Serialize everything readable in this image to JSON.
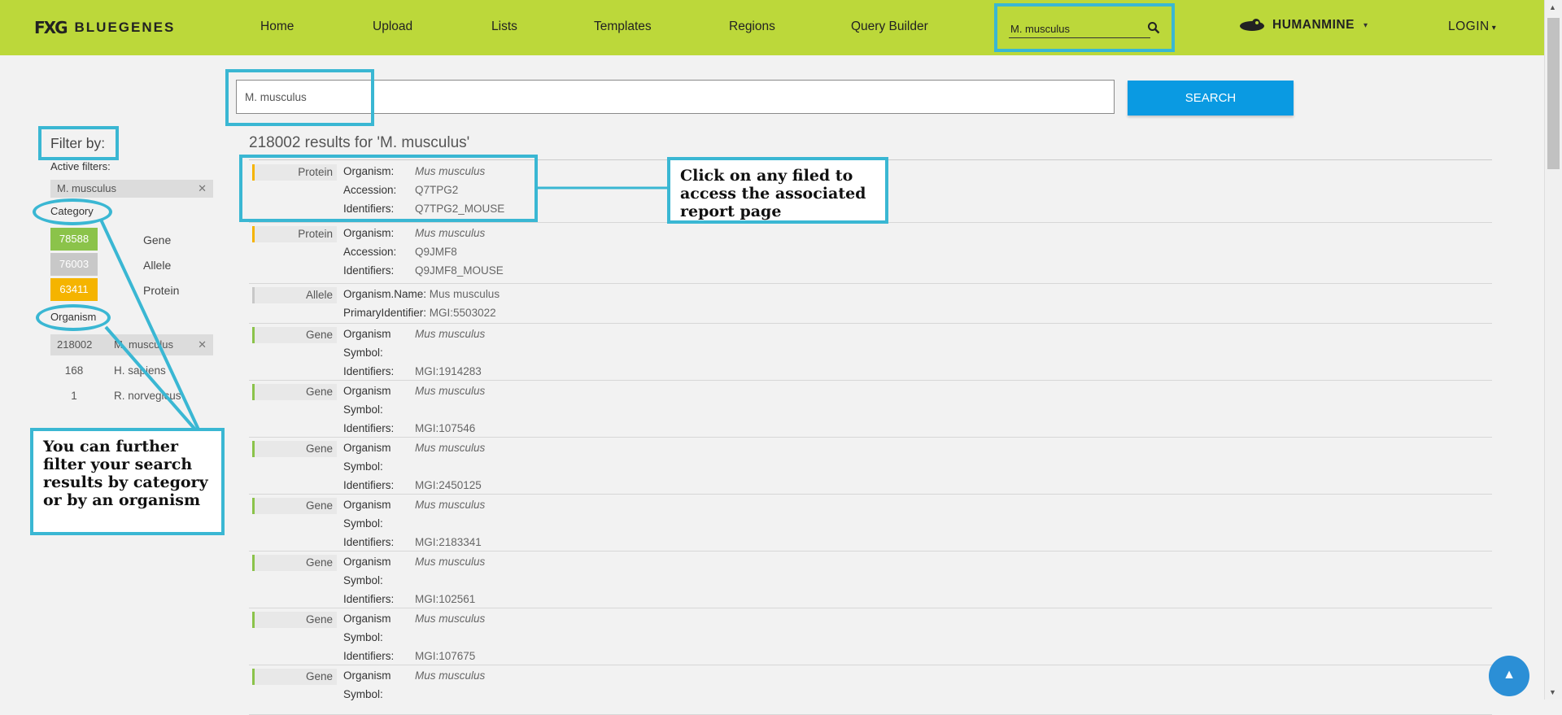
{
  "navbar": {
    "brand_logo": "FXG",
    "brand_name": "BLUEGENES",
    "links": [
      "Home",
      "Upload",
      "Lists",
      "Templates",
      "Regions",
      "Query Builder"
    ],
    "search_value": "M. musculus",
    "mine_name": "HUMANMINE",
    "login_label": "LOGIN"
  },
  "search": {
    "value": "M. musculus",
    "button_label": "SEARCH",
    "results_title": "218002 results for 'M. musculus'"
  },
  "filters": {
    "title": "Filter by:",
    "active_label": "Active filters:",
    "active_chip": "M. musculus",
    "close_glyph": "✕",
    "category_label": "Category",
    "categories": [
      {
        "count": "78588",
        "name": "Gene",
        "color": "#8bc34a"
      },
      {
        "count": "76003",
        "name": "Allele",
        "color": "#c8c8c8"
      },
      {
        "count": "63411",
        "name": "Protein",
        "color": "#f5b400"
      }
    ],
    "organism_label": "Organism",
    "organism_selected": {
      "count": "218002",
      "name": "M. musculus"
    },
    "organisms": [
      {
        "count": "168",
        "name": "H. sapiens"
      },
      {
        "count": "1",
        "name": "R. norvegicus"
      }
    ]
  },
  "results": [
    {
      "type": "Protein",
      "fields": [
        {
          "label": "Organism:",
          "value": "Mus musculus",
          "italic": true
        },
        {
          "label": "Accession:",
          "value": "Q7TPG2"
        },
        {
          "label": "Identifiers:",
          "value": "Q7TPG2_MOUSE"
        }
      ]
    },
    {
      "type": "Protein",
      "fields": [
        {
          "label": "Organism:",
          "value": "Mus musculus",
          "italic": true
        },
        {
          "label": "Accession:",
          "value": "Q9JMF8"
        },
        {
          "label": "Identifiers:",
          "value": "Q9JMF8_MOUSE"
        }
      ]
    },
    {
      "type": "Allele",
      "fields": [
        {
          "label": "Organism.Name:",
          "value": "Mus musculus"
        },
        {
          "label": "PrimaryIdentifier:",
          "value": "MGI:5503022"
        }
      ]
    },
    {
      "type": "Gene",
      "fields": [
        {
          "label": "Organism",
          "value": "Mus musculus",
          "italic": true
        },
        {
          "label": "Symbol:",
          "value": ""
        },
        {
          "label": "Identifiers:",
          "value": "MGI:1914283"
        }
      ]
    },
    {
      "type": "Gene",
      "fields": [
        {
          "label": "Organism",
          "value": "Mus musculus",
          "italic": true
        },
        {
          "label": "Symbol:",
          "value": ""
        },
        {
          "label": "Identifiers:",
          "value": "MGI:107546"
        }
      ]
    },
    {
      "type": "Gene",
      "fields": [
        {
          "label": "Organism",
          "value": "Mus musculus",
          "italic": true
        },
        {
          "label": "Symbol:",
          "value": ""
        },
        {
          "label": "Identifiers:",
          "value": "MGI:2450125"
        }
      ]
    },
    {
      "type": "Gene",
      "fields": [
        {
          "label": "Organism",
          "value": "Mus musculus",
          "italic": true
        },
        {
          "label": "Symbol:",
          "value": ""
        },
        {
          "label": "Identifiers:",
          "value": "MGI:2183341"
        }
      ]
    },
    {
      "type": "Gene",
      "fields": [
        {
          "label": "Organism",
          "value": "Mus musculus",
          "italic": true
        },
        {
          "label": "Symbol:",
          "value": ""
        },
        {
          "label": "Identifiers:",
          "value": "MGI:102561"
        }
      ]
    },
    {
      "type": "Gene",
      "fields": [
        {
          "label": "Organism",
          "value": "Mus musculus",
          "italic": true
        },
        {
          "label": "Symbol:",
          "value": ""
        },
        {
          "label": "Identifiers:",
          "value": "MGI:107675"
        }
      ]
    },
    {
      "type": "Gene",
      "fields": [
        {
          "label": "Organism",
          "value": "Mus musculus",
          "italic": true
        },
        {
          "label": "Symbol:",
          "value": ""
        }
      ]
    }
  ],
  "annotations": {
    "results_callout": "Click on any filed to access the associated report page",
    "filter_callout": "You can further filter your search results by category or by an organism"
  },
  "icons": {
    "search": "search-icon",
    "caret": "▾",
    "back_to_top": "▲"
  },
  "colors": {
    "navbar": "#bcd83a",
    "highlight": "#3ab7d3",
    "search_button": "#0a9ae2"
  }
}
